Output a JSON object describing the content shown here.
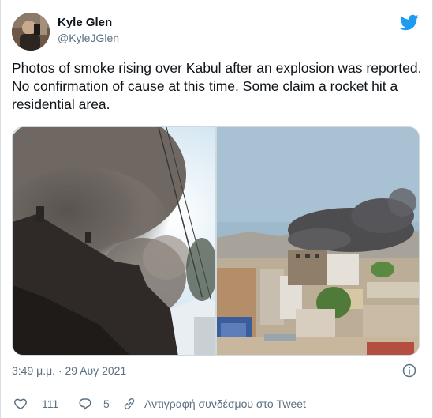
{
  "colors": {
    "twitter_blue": "#1d9bf0",
    "text": "#0f1419",
    "secondary": "#5b7083"
  },
  "author": {
    "display_name": "Kyle Glen",
    "handle": "@KyleJGlen"
  },
  "tweet": {
    "text": "Photos of smoke rising over Kabul after an explosion was reported. No confirmation of cause at this time. Some claim a rocket hit a residential area.",
    "timestamp": "3:49 μ.μ. · 29 Αυγ 2021"
  },
  "icons": {
    "brand": "twitter-bird-icon",
    "info": "info-icon",
    "like": "heart-icon",
    "reply": "reply-bubble-icon",
    "copy_link": "link-icon"
  },
  "actions": {
    "likes": "111",
    "replies": "5",
    "copy_link_label": "Αντιγραφή συνδέσμου στο Tweet"
  }
}
